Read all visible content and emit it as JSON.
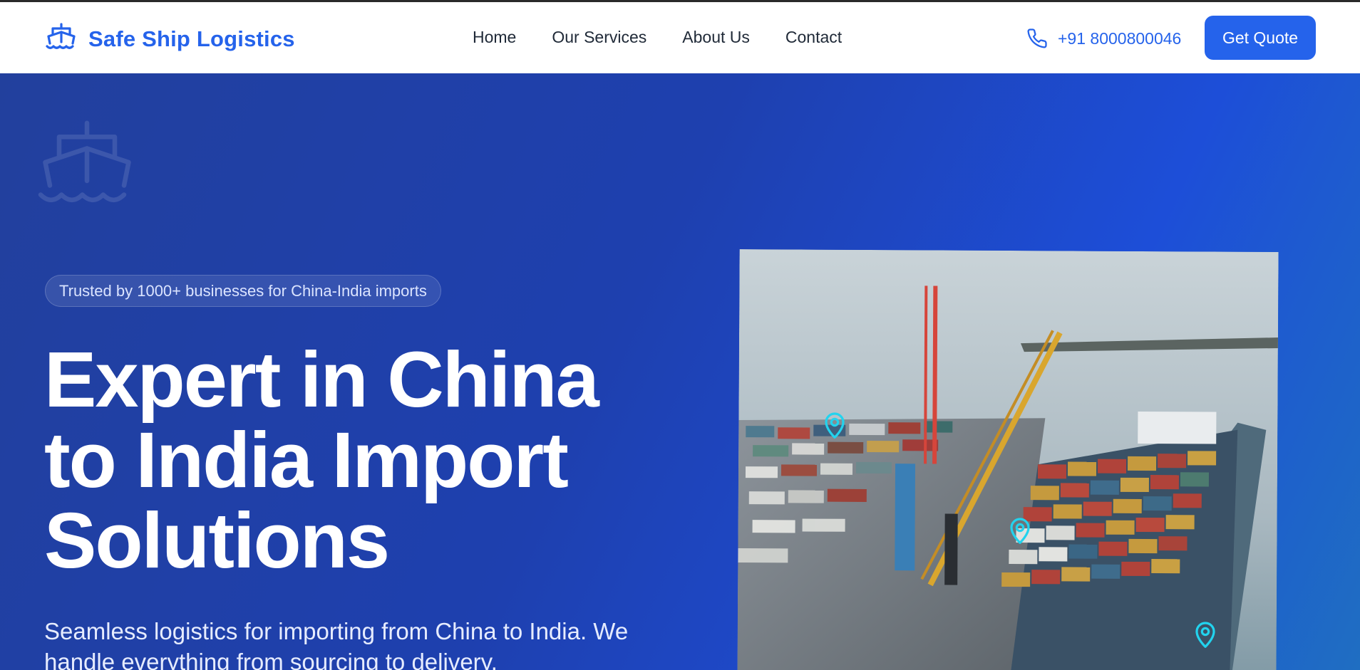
{
  "nav": {
    "brand": "Safe Ship Logistics",
    "links": [
      "Home",
      "Our Services",
      "About Us",
      "Contact"
    ],
    "phone": "+91 8000800046",
    "cta": "Get Quote",
    "brand_icon": "ship-icon",
    "phone_icon": "phone-icon"
  },
  "hero": {
    "badge": "Trusted by 1000+ businesses for China-India imports",
    "headline": "Expert in China to India Import Solutions",
    "subtext": "Seamless logistics for importing from China to India. We handle everything from sourcing to delivery.",
    "image_subject": "container port with cargo ship",
    "pin_icon": "map-pin-icon"
  },
  "colors": {
    "brand_blue": "#2563eb",
    "hero_bg": "#1e40af",
    "pin": "#22d3ee"
  }
}
